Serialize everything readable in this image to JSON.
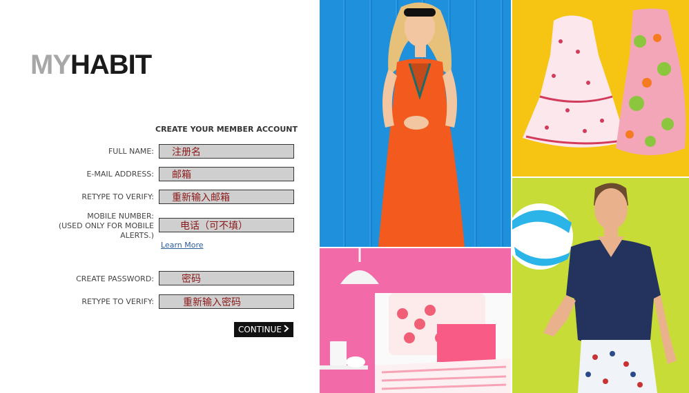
{
  "brand": {
    "prefix": "MY",
    "name": "HABIT"
  },
  "form": {
    "title": "CREATE YOUR MEMBER ACCOUNT",
    "fields": [
      {
        "label": "FULL NAME:",
        "value": "注册名"
      },
      {
        "label": "E-MAIL ADDRESS:",
        "value": "邮箱"
      },
      {
        "label": "RETYPE TO VERIFY:",
        "value": "重新输入邮箱"
      },
      {
        "label_lines": [
          "MOBILE NUMBER:",
          "(USED ONLY FOR MOBILE",
          "ALERTS.)"
        ],
        "value": "电话（可不填）"
      },
      {
        "label": "CREATE PASSWORD:",
        "value": "密码"
      },
      {
        "label": "RETYPE TO VERIFY:",
        "value": "重新输入密码"
      }
    ],
    "learn_more": "Learn More",
    "continue_label": "CONTINUE",
    "continue_icon": "chevron-right-icon"
  },
  "colors": {
    "field_bg": "#cfcfcf",
    "field_text": "#8b1a1a",
    "button_bg": "#111111",
    "link": "#2a5c9a"
  }
}
